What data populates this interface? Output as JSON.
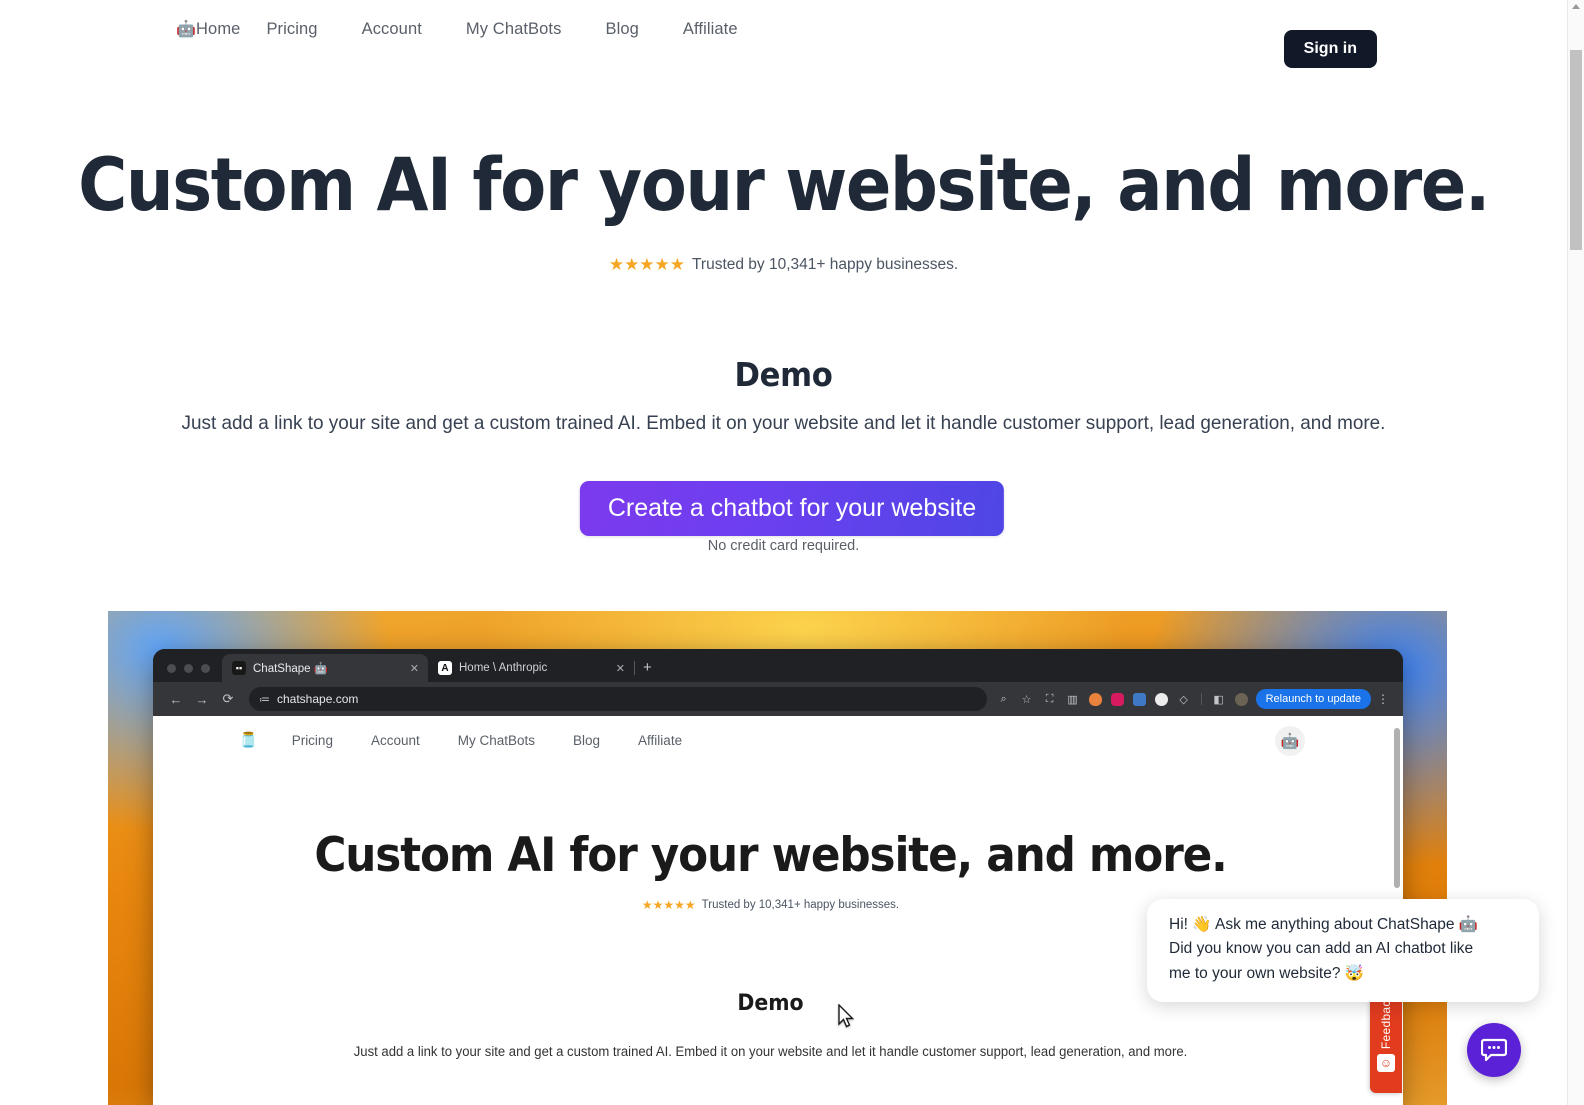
{
  "nav": {
    "home_icon": "robot-emoji",
    "items": [
      {
        "label": "Home",
        "icon": "robot-emoji"
      },
      {
        "label": "Pricing"
      },
      {
        "label": "Account"
      },
      {
        "label": "My ChatBots"
      },
      {
        "label": "Blog"
      },
      {
        "label": "Affiliate"
      }
    ],
    "signin_label": "Sign in"
  },
  "hero": {
    "title": "Custom AI for your website, and more.",
    "stars": "★★★★★",
    "star_count": 5,
    "star_color": "#f5a623",
    "trust_text": "Trusted by 10,341+ happy businesses."
  },
  "demo": {
    "title": "Demo",
    "subtitle": "Just add a link to your site and get a custom trained AI. Embed it on your website and let it handle customer support, lead generation, and more.",
    "cta_label": "Create a chatbot for your website",
    "cta_note": "No credit card required.",
    "cta_gradient_from": "#7c3aed",
    "cta_gradient_to": "#4f46e5"
  },
  "inner_browser": {
    "tabs": [
      {
        "title": "ChatShape 🤖",
        "favicon": "chatshape-favicon",
        "close": "✕",
        "active": true
      },
      {
        "title": "Home \\ Anthropic",
        "favicon": "anthropic-favicon",
        "close": "✕",
        "active": false
      }
    ],
    "new_tab": "+",
    "back_icon": "←",
    "forward_icon": "→",
    "reload_icon": "⟳",
    "url": "chatshape.com",
    "tune_icon": "tune-icon",
    "toolbar_icons": [
      "zoom-icon",
      "bookmark-star-icon",
      "share-icon",
      "split-view-icon",
      "extension-icon",
      "pocket-icon",
      "profile-ext-icon",
      "opera-ext-icon",
      "dropbox-icon",
      "sidebar-icon",
      "profile-avatar-icon"
    ],
    "relaunch_label": "Relaunch to update",
    "kebab_icon": "⋮",
    "page": {
      "logo": "chatshape-logo",
      "nav": [
        "Pricing",
        "Account",
        "My ChatBots",
        "Blog",
        "Affiliate"
      ],
      "avatar_icon": "robot-avatar",
      "title": "Custom AI for your website, and more.",
      "stars": "★★★★★",
      "trust_text": "Trusted by 10,341+ happy businesses.",
      "demo_title": "Demo",
      "demo_subtitle": "Just add a link to your site and get a custom trained AI. Embed it on your website and let it handle customer support, lead generation, and more."
    }
  },
  "chat_tooltip": {
    "line1": "Hi! 👋 Ask me anything about ChatShape 🤖",
    "line2": "Did you know you can add an AI chatbot like",
    "line3": "me to your own website? 🤯"
  },
  "feedback": {
    "label": "Feedback",
    "icon": "smiley-face-icon",
    "color": "#e23c1f"
  },
  "chat_launcher": {
    "icon": "chat-bubble-icon",
    "color": "#5b21d6"
  },
  "scrollbar": {
    "arrow_up": "▲"
  }
}
